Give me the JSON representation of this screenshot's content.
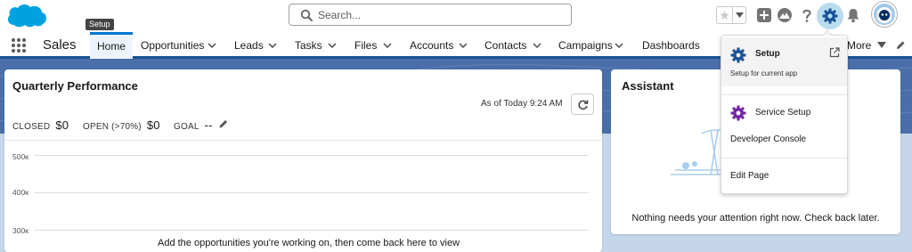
{
  "colors": {
    "brand_blue": "#0176d3",
    "header_band": "#4a6fa8",
    "setup_icon": "#1b5297",
    "service_setup_icon": "#7526a8",
    "cloud_logo": "#00a1e0"
  },
  "header": {
    "logo_icon": "salesforce-cloud-logo",
    "search": {
      "placeholder": "Search..."
    },
    "icons": [
      "favorite-star-icon",
      "favorites-list-chevron-icon",
      "add-icon",
      "trailhead-icon",
      "help-icon",
      "setup-gear-icon",
      "notifications-bell-icon",
      "user-avatar"
    ]
  },
  "tooltip": {
    "text": "Setup"
  },
  "nav": {
    "app_name": "Sales",
    "items": [
      {
        "label": "Home",
        "active": true
      },
      {
        "label": "Opportunities"
      },
      {
        "label": "Leads"
      },
      {
        "label": "Tasks"
      },
      {
        "label": "Files"
      },
      {
        "label": "Accounts"
      },
      {
        "label": "Contacts"
      },
      {
        "label": "Campaigns"
      },
      {
        "label": "Dashboards"
      },
      {
        "label": "More"
      }
    ]
  },
  "performance": {
    "title": "Quarterly Performance",
    "as_of": "As of Today 9:24 AM",
    "closed_label": "CLOSED",
    "closed_value": "$0",
    "open_label": "OPEN (>70%)",
    "open_value": "$0",
    "goal_label": "GOAL",
    "goal_value": "--",
    "y_ticks": [
      "500κ",
      "400κ",
      "300κ"
    ],
    "empty_message": "Add the opportunities you're working on, then come back here to view"
  },
  "assistant": {
    "title": "Assistant",
    "message": "Nothing needs your attention right now. Check back later."
  },
  "setup_menu": {
    "items": [
      {
        "label": "Setup",
        "sub": "Setup for current app",
        "icon": "setup-gear-icon",
        "trailing_icon": "open-in-new-window-icon"
      },
      {
        "label": "Service Setup",
        "icon": "service-setup-gear-icon"
      },
      {
        "label": "Developer Console"
      },
      {
        "label": "Edit Page"
      }
    ]
  }
}
